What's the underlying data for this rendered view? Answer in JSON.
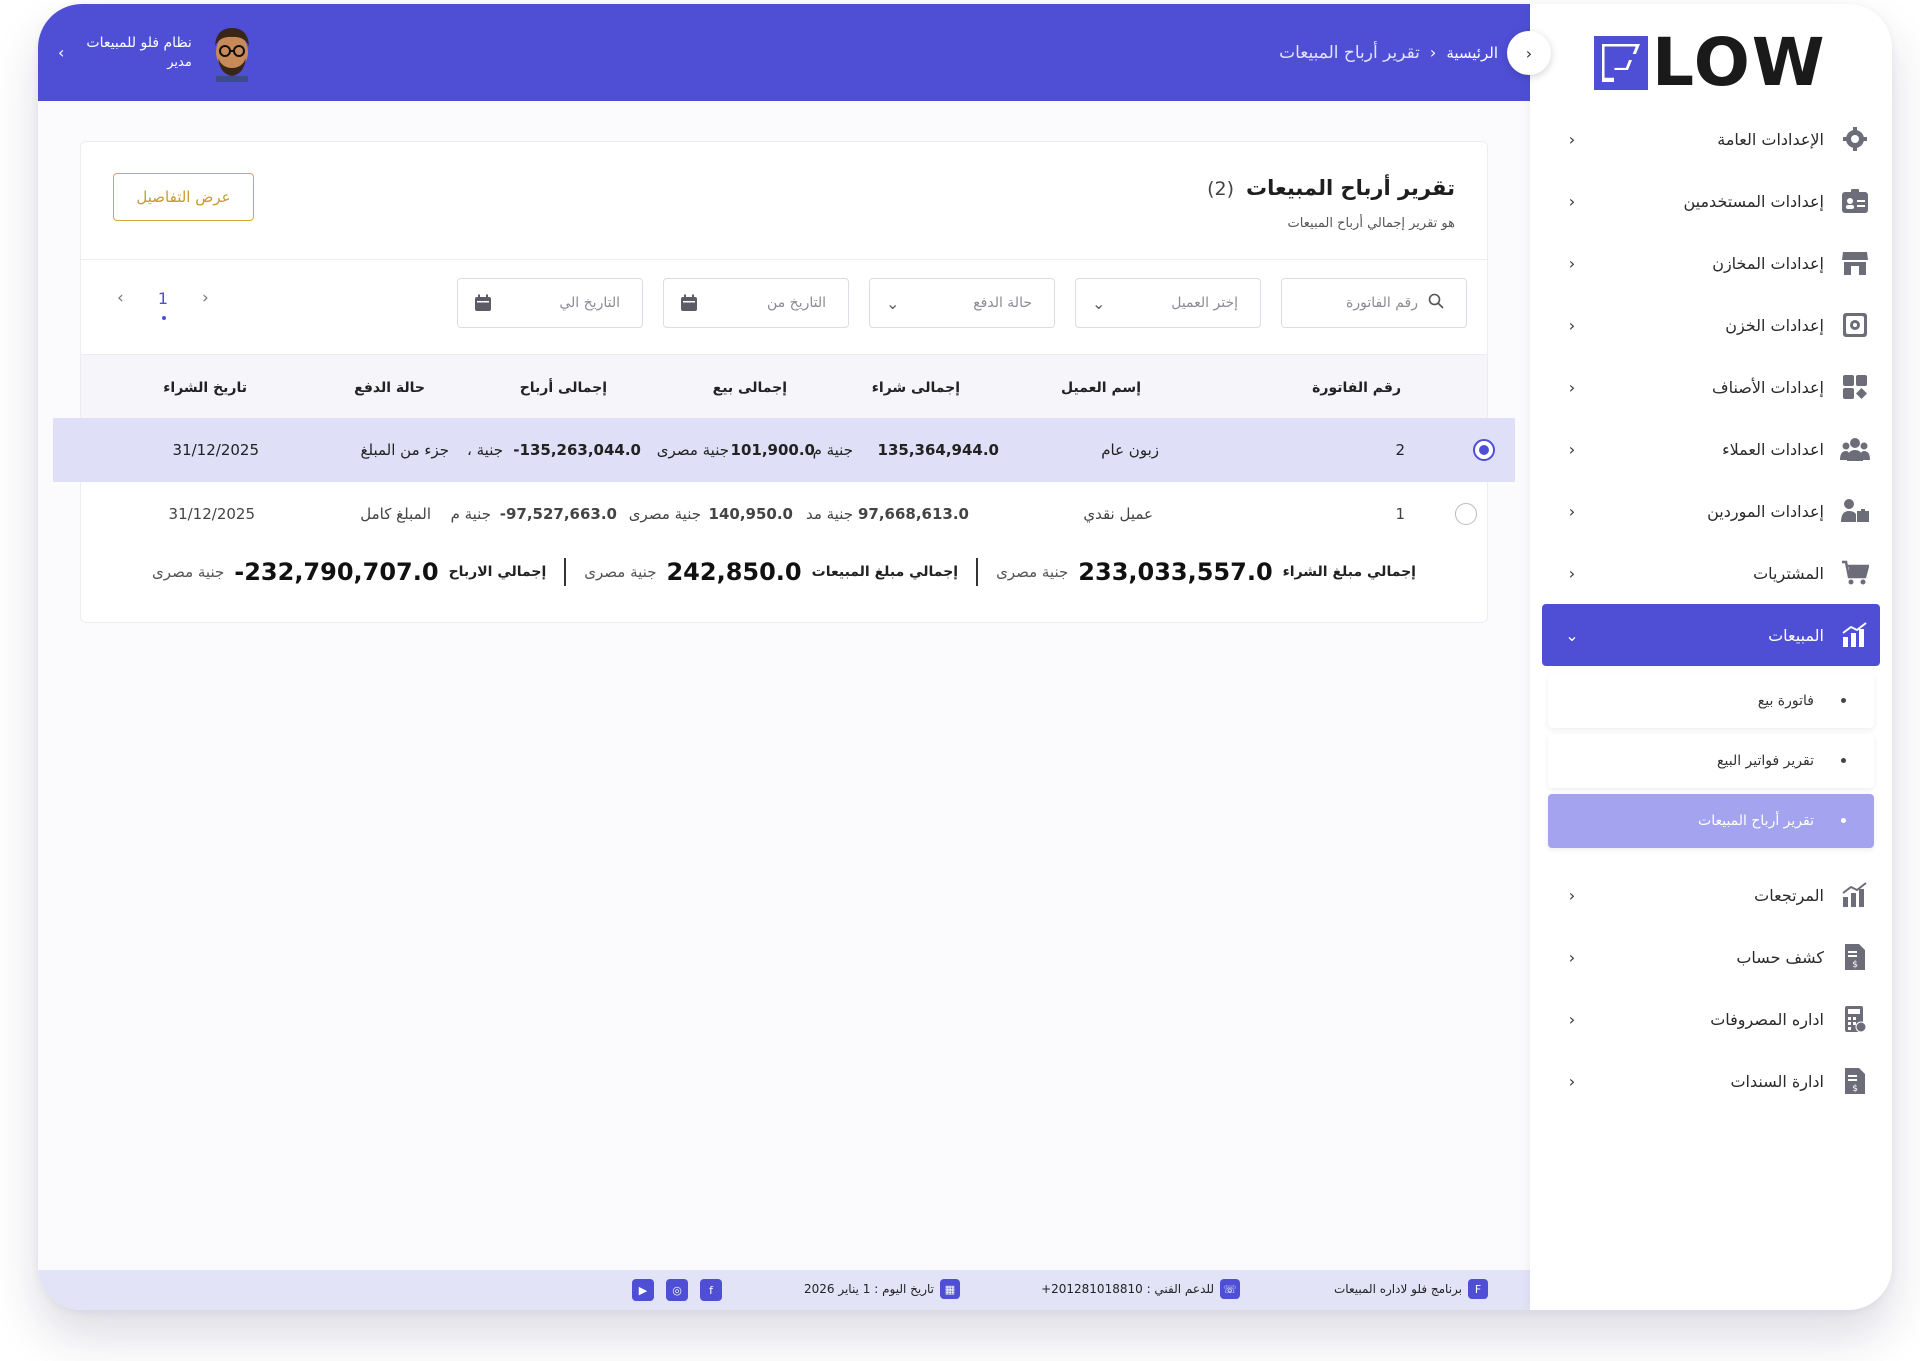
{
  "header": {
    "breadcrumb_home": "الرئيسية",
    "breadcrumb_current": "تقرير أرباح المبيعات",
    "user_name": "نظام فلو للمبيعات",
    "user_role": "مدير"
  },
  "sidebar": {
    "logo_text": "LOW",
    "items": [
      {
        "label": "الإعدادات العامة",
        "icon": "gear-icon"
      },
      {
        "label": "إعدادات المستخدمين",
        "icon": "id-card-icon"
      },
      {
        "label": "إعدادات المخازن",
        "icon": "store-icon"
      },
      {
        "label": "إعدادات الخزن",
        "icon": "safe-icon"
      },
      {
        "label": "إعدادات الأصناف",
        "icon": "categories-icon"
      },
      {
        "label": "اعدادات العملاء",
        "icon": "users-icon"
      },
      {
        "label": "إعدادات الموردين",
        "icon": "supplier-icon"
      },
      {
        "label": "المشتريات",
        "icon": "cart-icon"
      }
    ],
    "active": {
      "label": "المبيعات",
      "icon": "sales-chart-icon"
    },
    "sub_items": [
      {
        "label": "فاتورة بيع"
      },
      {
        "label": "تقرير فواتير البيع"
      },
      {
        "label": "تقرير أرباح المبيعات"
      }
    ],
    "items_after": [
      {
        "label": "المرتجعات",
        "icon": "returns-chart-icon"
      },
      {
        "label": "كشف حساب",
        "icon": "statement-icon"
      },
      {
        "label": "اداره المصروفات",
        "icon": "calculator-icon"
      },
      {
        "label": "ادارة السندات",
        "icon": "voucher-icon"
      }
    ]
  },
  "report": {
    "title": "تقرير أرباح المبيعات",
    "count": "(2)",
    "subtitle": "هو تقرير إجمالي أرباح المبيعات",
    "details_button": "عرض التفاصيل",
    "filters": {
      "invoice_placeholder": "رقم الفاتورة",
      "customer_placeholder": "إختر العميل",
      "payment_placeholder": "حالة الدفع",
      "date_from_placeholder": "التاريخ من",
      "date_to_placeholder": "التاريخ الي"
    },
    "pager": {
      "page": "1"
    },
    "columns": [
      "رقم الفاتورة",
      "إسم العميل",
      "إجمالى شراء",
      "إجمالى بيع",
      "إجمالى أرباح",
      "حالة الدفع",
      "تاريخ الشراء"
    ],
    "rows": [
      {
        "invoice": "2",
        "customer": "زبون عام",
        "purchase": "135,364,944.0",
        "purchase_cur": "جنية م",
        "sale": "101,900.0",
        "sale_cur": "جنية مصرى",
        "profit": "135,263,044.0-",
        "profit_cur": "جنية ،",
        "status": "جزء من المبلغ",
        "date": "31/12/2025",
        "selected": true
      },
      {
        "invoice": "1",
        "customer": "عميل نقدي",
        "purchase": "97,668,613.0",
        "purchase_cur": "جنية مد",
        "sale": "140,950.0",
        "sale_cur": "جنية مصرى",
        "profit": "97,527,663.0-",
        "profit_cur": "جنية م",
        "status": "المبلغ كامل",
        "date": "31/12/2025",
        "selected": false
      }
    ],
    "totals": {
      "purchase_label": "إجمالي مبلغ الشراء",
      "purchase_value": "233,033,557.0",
      "purchase_cur": "جنية مصرى",
      "sales_label": "إجمالي مبلغ المبيعات",
      "sales_value": "242,850.0",
      "sales_cur": "جنية مصرى",
      "profit_label": "إجمالي الارباح",
      "profit_value": "232,790,707.0-",
      "profit_cur": "جنية مصرى"
    }
  },
  "footer": {
    "program": "برنامج فلو لاداره المبيعات",
    "support": "للدعم الفني : 201281018810+",
    "today": "تاريخ اليوم : 1 يناير 2026",
    "social": [
      "facebook-icon",
      "instagram-icon",
      "youtube-icon"
    ]
  },
  "colors": {
    "primary": "#4e4fd5",
    "accent_gold": "#d6a93c",
    "selected_row": "#dfdff7"
  }
}
